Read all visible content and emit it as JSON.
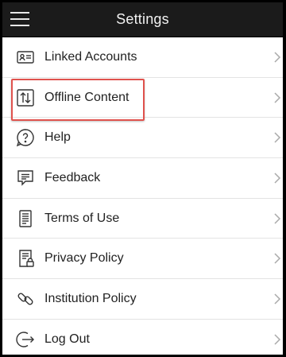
{
  "header": {
    "title": "Settings",
    "menu_icon": "hamburger-menu-icon"
  },
  "menu": [
    {
      "label": "Linked Accounts",
      "icon": "id-card-icon"
    },
    {
      "label": "Offline Content",
      "icon": "transfer-arrows-icon"
    },
    {
      "label": "Help",
      "icon": "help-circle-icon"
    },
    {
      "label": "Feedback",
      "icon": "feedback-icon"
    },
    {
      "label": "Terms of Use",
      "icon": "document-icon"
    },
    {
      "label": "Privacy Policy",
      "icon": "document-lock-icon"
    },
    {
      "label": "Institution Policy",
      "icon": "link-icon"
    },
    {
      "label": "Log Out",
      "icon": "logout-icon"
    }
  ],
  "highlighted_item": "Offline Content",
  "colors": {
    "header_bg": "#1b1b1b",
    "highlight_border": "#e0524d"
  }
}
